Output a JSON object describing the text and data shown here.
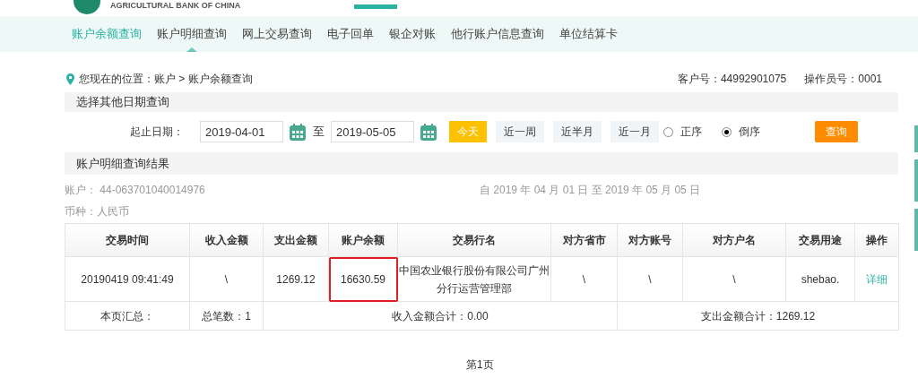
{
  "header": {
    "logo_text": "AGRICULTURAL BANK OF CHINA"
  },
  "nav": [
    {
      "label": "账户余额查询",
      "selected": true,
      "pointer": false
    },
    {
      "label": "账户明细查询",
      "selected": false,
      "pointer": true
    },
    {
      "label": "网上交易查询",
      "selected": false,
      "pointer": false
    },
    {
      "label": "电子回单",
      "selected": false,
      "pointer": false
    },
    {
      "label": "银企对账",
      "selected": false,
      "pointer": false
    },
    {
      "label": "他行账户信息查询",
      "selected": false,
      "pointer": false
    },
    {
      "label": "单位结算卡",
      "selected": false,
      "pointer": false
    }
  ],
  "breadcrumb": "您现在的位置：账户 > 账户余额查询",
  "customer_no": "客户号：44992901075",
  "operator_no": "操作员号：0001",
  "date_section": {
    "title": "选择其他日期查询",
    "label": "起止日期：",
    "start": "2019-04-01",
    "to": "至",
    "end": "2019-05-05",
    "quick": [
      {
        "label": "今天",
        "selected": true
      },
      {
        "label": "近一周",
        "selected": false
      },
      {
        "label": "近半月",
        "selected": false
      },
      {
        "label": "近一月",
        "selected": false
      }
    ],
    "order": [
      {
        "label": "正序",
        "selected": false
      },
      {
        "label": "倒序",
        "selected": true
      }
    ],
    "query_button": "查询"
  },
  "result_section": {
    "title": "账户明细查询结果",
    "account": "账户： 44-063701040014976",
    "range": "自 2019 年 04 月 01 日 至 2019 年 05 月 05 日",
    "currency": "币种：人民币"
  },
  "table": {
    "columns": [
      "交易时间",
      "收入金额",
      "支出金额",
      "账户余额",
      "交易行名",
      "对方省市",
      "对方账号",
      "对方户名",
      "交易用途",
      "操作"
    ],
    "rows": [
      {
        "cells": [
          "20190419 09:41:49",
          "\\",
          "1269.12",
          "16630.59",
          "中国农业银行股份有限公司广州分行运营管理部",
          "\\",
          "\\",
          "\\",
          "shebao.",
          "详细"
        ],
        "highlighted": [
          false,
          false,
          false,
          true,
          false,
          false,
          false,
          false,
          false,
          false
        ]
      }
    ],
    "summary": [
      "本页汇总：",
      "总笔数：1",
      "收入金额合计：0.00",
      "支出金额合计：1269.12"
    ]
  },
  "pager": "第1页"
}
